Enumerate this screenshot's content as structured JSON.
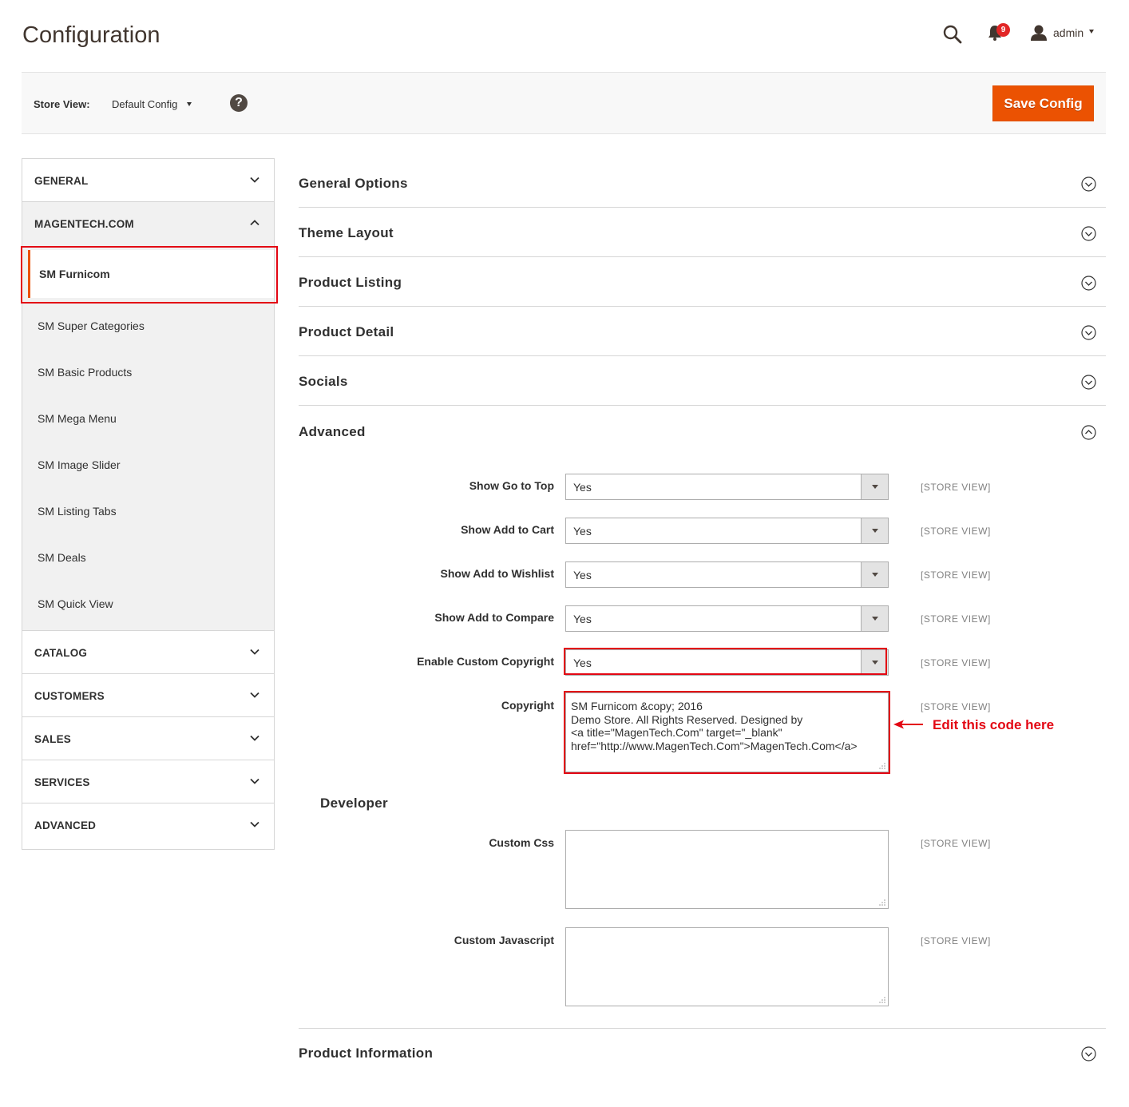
{
  "header": {
    "title": "Configuration",
    "notifications_count": "9",
    "username": "admin"
  },
  "store_bar": {
    "label": "Store View:",
    "value": "Default Config",
    "help_glyph": "?",
    "save_label": "Save Config"
  },
  "sidebar": {
    "general": "GENERAL",
    "magentech": "MAGENTECH.COM",
    "items": [
      "SM Furnicom",
      "SM Super Categories",
      "SM Basic Products",
      "SM Mega Menu",
      "SM Image Slider",
      "SM Listing Tabs",
      "SM Deals",
      "SM Quick View"
    ],
    "catalog": "CATALOG",
    "customers": "CUSTOMERS",
    "sales": "SALES",
    "services": "SERVICES",
    "advanced": "ADVANCED"
  },
  "sections": {
    "general_options": "General Options",
    "theme_layout": "Theme Layout",
    "product_listing": "Product Listing",
    "product_detail": "Product Detail",
    "socials": "Socials",
    "advanced": "Advanced",
    "product_information": "Product Information"
  },
  "advanced": {
    "fields": [
      {
        "label": "Show Go to Top",
        "value": "Yes",
        "scope": "[STORE VIEW]"
      },
      {
        "label": "Show Add to Cart",
        "value": "Yes",
        "scope": "[STORE VIEW]"
      },
      {
        "label": "Show Add to Wishlist",
        "value": "Yes",
        "scope": "[STORE VIEW]"
      },
      {
        "label": "Show Add to Compare",
        "value": "Yes",
        "scope": "[STORE VIEW]"
      },
      {
        "label": "Enable Custom Copyright",
        "value": "Yes",
        "scope": "[STORE VIEW]"
      }
    ],
    "copyright": {
      "label": "Copyright",
      "value": "SM Furnicom &copy; 2016\nDemo Store. All Rights Reserved. Designed by\n<a title=\"MagenTech.Com\" target=\"_blank\"\nhref=\"http://www.MagenTech.Com\">MagenTech.Com</a>",
      "scope": "[STORE VIEW]"
    },
    "annotation": "Edit this code here"
  },
  "developer": {
    "title": "Developer",
    "custom_css": {
      "label": "Custom Css",
      "value": "",
      "scope": "[STORE VIEW]"
    },
    "custom_js": {
      "label": "Custom Javascript",
      "value": "",
      "scope": "[STORE VIEW]"
    }
  }
}
